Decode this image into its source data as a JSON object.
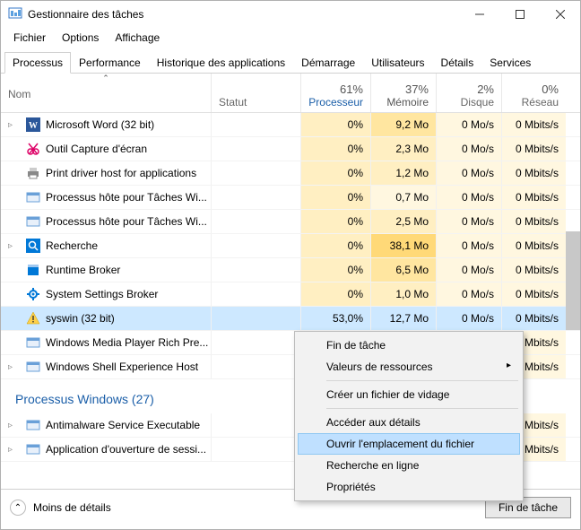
{
  "window": {
    "title": "Gestionnaire des tâches"
  },
  "menu": {
    "file": "Fichier",
    "options": "Options",
    "view": "Affichage"
  },
  "tabs": {
    "items": [
      {
        "label": "Processus",
        "active": true
      },
      {
        "label": "Performance"
      },
      {
        "label": "Historique des applications"
      },
      {
        "label": "Démarrage"
      },
      {
        "label": "Utilisateurs"
      },
      {
        "label": "Détails"
      },
      {
        "label": "Services"
      }
    ]
  },
  "columns": {
    "name": "Nom",
    "status": "Statut",
    "cpu": {
      "percent": "61%",
      "label": "Processeur"
    },
    "mem": {
      "percent": "37%",
      "label": "Mémoire"
    },
    "disk": {
      "percent": "2%",
      "label": "Disque"
    },
    "net": {
      "percent": "0%",
      "label": "Réseau"
    }
  },
  "groups": {
    "windows": {
      "label": "Processus Windows (27)"
    }
  },
  "processes": [
    {
      "icon": "word-icon",
      "name": "Microsoft Word (32 bit)",
      "cpu": "0%",
      "mem": "9,2 Mo",
      "disk": "0 Mo/s",
      "net": "0 Mbits/s",
      "expand": true
    },
    {
      "icon": "snip-icon",
      "name": "Outil Capture d'écran",
      "cpu": "0%",
      "mem": "2,3 Mo",
      "disk": "0 Mo/s",
      "net": "0 Mbits/s"
    },
    {
      "icon": "printer-icon",
      "name": "Print driver host for applications",
      "cpu": "0%",
      "mem": "1,2 Mo",
      "disk": "0 Mo/s",
      "net": "0 Mbits/s"
    },
    {
      "icon": "generic-icon",
      "name": "Processus hôte pour Tâches Wi...",
      "cpu": "0%",
      "mem": "0,7 Mo",
      "disk": "0 Mo/s",
      "net": "0 Mbits/s"
    },
    {
      "icon": "generic-icon",
      "name": "Processus hôte pour Tâches Wi...",
      "cpu": "0%",
      "mem": "2,5 Mo",
      "disk": "0 Mo/s",
      "net": "0 Mbits/s"
    },
    {
      "icon": "search-icon",
      "name": "Recherche",
      "cpu": "0%",
      "mem": "38,1 Mo",
      "disk": "0 Mo/s",
      "net": "0 Mbits/s",
      "expand": true
    },
    {
      "icon": "runtime-icon",
      "name": "Runtime Broker",
      "cpu": "0%",
      "mem": "6,5 Mo",
      "disk": "0 Mo/s",
      "net": "0 Mbits/s"
    },
    {
      "icon": "gear-icon",
      "name": "System Settings Broker",
      "cpu": "0%",
      "mem": "1,0 Mo",
      "disk": "0 Mo/s",
      "net": "0 Mbits/s"
    },
    {
      "icon": "warn-icon",
      "name": "syswin (32 bit)",
      "cpu": "53,0%",
      "mem": "12,7 Mo",
      "disk": "0 Mo/s",
      "net": "0 Mbits/s",
      "selected": true
    },
    {
      "icon": "generic-icon",
      "name": "Windows Media Player Rich Pre...",
      "cpu": "",
      "mem": "",
      "disk": "",
      "net": "0 Mbits/s"
    },
    {
      "icon": "generic-icon",
      "name": "Windows Shell Experience Host",
      "cpu": "",
      "mem": "",
      "disk": "",
      "net": "0 Mbits/s",
      "expand": true
    }
  ],
  "win_processes": [
    {
      "icon": "generic-icon",
      "name": "Antimalware Service Executable",
      "cpu": "",
      "mem": "",
      "disk": "",
      "net": "0 Mbits/s",
      "expand": true
    },
    {
      "icon": "generic-icon",
      "name": "Application d'ouverture de sessi...",
      "cpu": "",
      "mem": "",
      "disk": "",
      "net": "0 Mbits/s",
      "expand": true
    }
  ],
  "context_menu": {
    "items": [
      {
        "label": "Fin de tâche"
      },
      {
        "label": "Valeurs de ressources",
        "submenu": true
      },
      {
        "sep": true
      },
      {
        "label": "Créer un fichier de vidage"
      },
      {
        "sep": true
      },
      {
        "label": "Accéder aux détails"
      },
      {
        "label": "Ouvrir l'emplacement du fichier",
        "hover": true
      },
      {
        "label": "Recherche en ligne"
      },
      {
        "label": "Propriétés"
      }
    ]
  },
  "footer": {
    "less_details": "Moins de détails",
    "end_task": "Fin de tâche"
  }
}
